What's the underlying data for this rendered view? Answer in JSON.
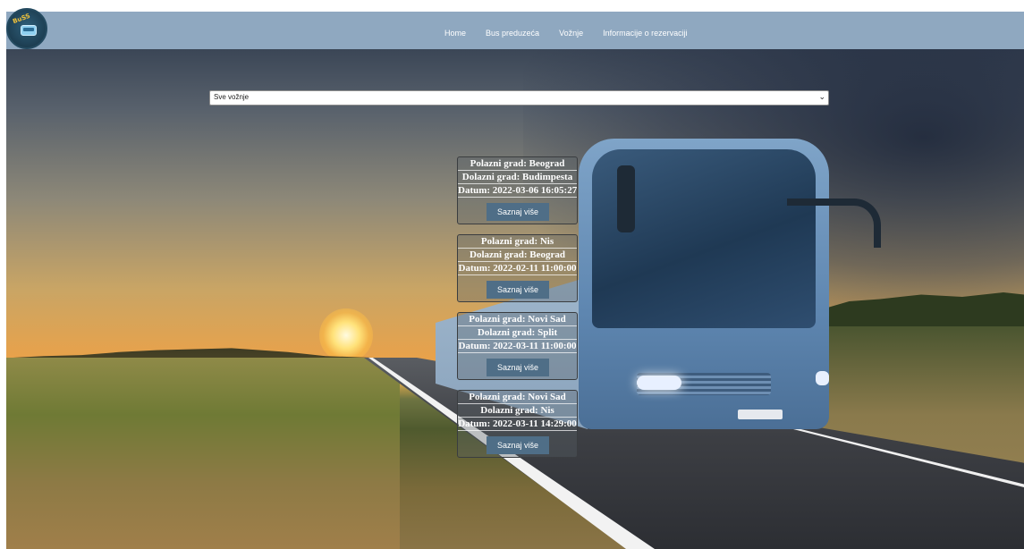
{
  "nav": {
    "logo_text": "BuSS",
    "links": [
      {
        "label": "Home"
      },
      {
        "label": "Bus preduzeća"
      },
      {
        "label": "Vožnje"
      },
      {
        "label": "Informacije o rezervaciji"
      }
    ]
  },
  "filter": {
    "selected": "Sve vožnje"
  },
  "rides": [
    {
      "from": "Polazni grad: Beograd",
      "to": "Dolazni grad: Budimpesta",
      "date": "Datum: 2022-03-06 16:05:27",
      "button": "Saznaj više"
    },
    {
      "from": "Polazni grad: Nis",
      "to": "Dolazni grad: Beograd",
      "date": "Datum: 2022-02-11 11:00:00",
      "button": "Saznaj više"
    },
    {
      "from": "Polazni grad: Novi Sad",
      "to": "Dolazni grad: Split",
      "date": "Datum: 2022-03-11 11:00:00",
      "button": "Saznaj više"
    },
    {
      "from": "Polazni grad: Novi Sad",
      "to": "Dolazni grad: Nis",
      "date": "Datum: 2022-03-11 14:29:00",
      "button": "Saznaj više"
    }
  ],
  "colors": {
    "navbar": "#8fa8c0",
    "button": "#4f6e87"
  }
}
